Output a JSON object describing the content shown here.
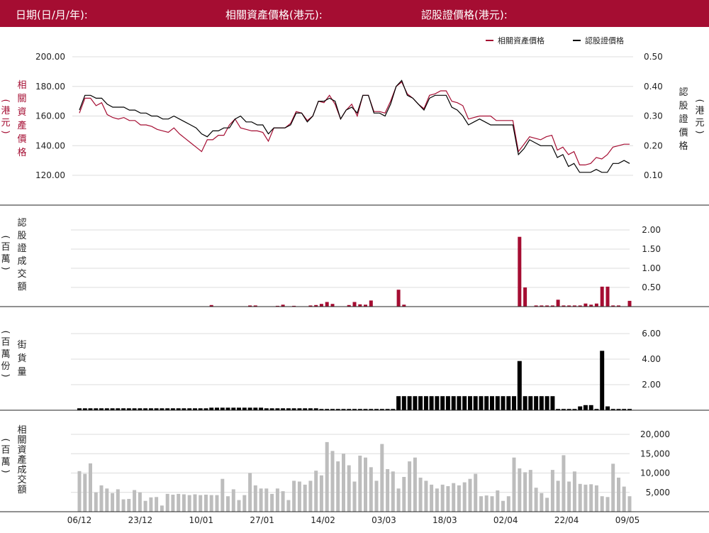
{
  "header": {
    "date_label": "日期(日/月/年):",
    "asset_price_label": "相關資產價格(港元):",
    "warrant_price_label": "認股證價格(港元):"
  },
  "colors": {
    "brand": "#a50d32",
    "asset": "#a50d32",
    "warrant": "#000000",
    "turnover_bar": "#bdbdbd",
    "grid": "#dcdcdc"
  },
  "chart_data": [
    {
      "type": "line",
      "legend": [
        "相關資產價格",
        "認股證價格"
      ],
      "legend_position": "top-right",
      "left_axis": {
        "label_chars": [
          "相",
          "關",
          "資",
          "產",
          "價",
          "格"
        ],
        "unit": "(港元)",
        "ticks": [
          "200.00",
          "180.00",
          "160.00",
          "140.00",
          "120.00"
        ],
        "range": [
          110,
          200
        ]
      },
      "right_axis": {
        "label_chars": [
          "認",
          "股",
          "證",
          "價",
          "格"
        ],
        "unit": "(港元)",
        "ticks": [
          "0.50",
          "0.40",
          "0.30",
          "0.20",
          "0.10"
        ],
        "range": [
          0.05,
          0.5
        ]
      },
      "series": [
        {
          "name": "相關資產價格",
          "axis": "left",
          "values": [
            162,
            172,
            172,
            167,
            169,
            161,
            159,
            158,
            159,
            157,
            157,
            154,
            154,
            153,
            151,
            150,
            149,
            152,
            148,
            145,
            142,
            139,
            136,
            144,
            144,
            147,
            147,
            154,
            158,
            152,
            151,
            150,
            150,
            149,
            143,
            152,
            152,
            152,
            155,
            163,
            162,
            157,
            160,
            170,
            169,
            174,
            168,
            158,
            164,
            168,
            160,
            174,
            174,
            163,
            163,
            162,
            170,
            180,
            183,
            175,
            172,
            168,
            165,
            174,
            175,
            177,
            177,
            170,
            169,
            167,
            158,
            159,
            160,
            160,
            160,
            157,
            157,
            157,
            157,
            136,
            141,
            146,
            145,
            144,
            146,
            147,
            137,
            139,
            134,
            136,
            127,
            127,
            128,
            132,
            131,
            134,
            139,
            140,
            141,
            141
          ]
        },
        {
          "name": "認股證價格",
          "axis": "right",
          "values": [
            0.32,
            0.37,
            0.37,
            0.36,
            0.36,
            0.34,
            0.33,
            0.33,
            0.33,
            0.32,
            0.32,
            0.31,
            0.31,
            0.3,
            0.3,
            0.29,
            0.29,
            0.3,
            0.29,
            0.28,
            0.27,
            0.26,
            0.24,
            0.23,
            0.25,
            0.25,
            0.26,
            0.26,
            0.29,
            0.3,
            0.28,
            0.28,
            0.27,
            0.27,
            0.24,
            0.26,
            0.26,
            0.26,
            0.27,
            0.31,
            0.31,
            0.28,
            0.3,
            0.35,
            0.35,
            0.36,
            0.35,
            0.29,
            0.32,
            0.33,
            0.31,
            0.37,
            0.37,
            0.31,
            0.31,
            0.3,
            0.34,
            0.4,
            0.42,
            0.37,
            0.36,
            0.34,
            0.32,
            0.36,
            0.37,
            0.37,
            0.37,
            0.33,
            0.32,
            0.3,
            0.27,
            0.28,
            0.29,
            0.28,
            0.27,
            0.27,
            0.27,
            0.27,
            0.27,
            0.17,
            0.19,
            0.22,
            0.21,
            0.2,
            0.2,
            0.2,
            0.16,
            0.17,
            0.13,
            0.14,
            0.11,
            0.11,
            0.11,
            0.12,
            0.11,
            0.11,
            0.14,
            0.14,
            0.15,
            0.14
          ]
        }
      ]
    },
    {
      "type": "bar",
      "left_axis": {
        "label_chars": [
          "認",
          "股",
          "證",
          "成",
          "交",
          "額"
        ],
        "unit": "(百萬)"
      },
      "right_axis": {
        "ticks": [
          "2.00",
          "1.50",
          "1.00",
          "0.50"
        ],
        "range": [
          0,
          2.2
        ]
      },
      "values": [
        0,
        0,
        0,
        0,
        0,
        0,
        0,
        0,
        0,
        0,
        0,
        0,
        0,
        0,
        0,
        0,
        0,
        0,
        0,
        0,
        0,
        0,
        0,
        0,
        0.04,
        0,
        0,
        0,
        0,
        0,
        0,
        0.03,
        0.03,
        0,
        0,
        0,
        0.02,
        0.05,
        0,
        0.02,
        0,
        0,
        0.03,
        0.04,
        0.07,
        0.12,
        0.07,
        0.01,
        0,
        0.04,
        0.12,
        0.06,
        0.05,
        0.16,
        0,
        0,
        0,
        0,
        0.44,
        0.05,
        0,
        0,
        0,
        0,
        0,
        0,
        0,
        0,
        0,
        0,
        0,
        0,
        0,
        0,
        0,
        0,
        0,
        0,
        0,
        0,
        1.82,
        0.5,
        0,
        0.03,
        0.03,
        0.03,
        0.03,
        0.18,
        0.03,
        0.03,
        0.03,
        0.03,
        0.08,
        0.05,
        0.08,
        0.52,
        0.52,
        0.03,
        0.03,
        0,
        0.15
      ]
    },
    {
      "type": "bar",
      "left_axis": {
        "label_chars": [
          "街",
          "貨",
          "量"
        ],
        "unit": "(百萬份)"
      },
      "right_axis": {
        "ticks": [
          "6.00",
          "4.00",
          "2.00"
        ],
        "range": [
          0,
          6.5
        ]
      },
      "values": [
        0.15,
        0.15,
        0.15,
        0.15,
        0.15,
        0.15,
        0.15,
        0.15,
        0.15,
        0.15,
        0.15,
        0.15,
        0.15,
        0.15,
        0.15,
        0.15,
        0.15,
        0.15,
        0.15,
        0.15,
        0.15,
        0.15,
        0.15,
        0.15,
        0.2,
        0.2,
        0.2,
        0.2,
        0.2,
        0.2,
        0.2,
        0.2,
        0.2,
        0.2,
        0.15,
        0.15,
        0.15,
        0.15,
        0.15,
        0.15,
        0.15,
        0.15,
        0.15,
        0.15,
        0.1,
        0.1,
        0.1,
        0.1,
        0.1,
        0.1,
        0.1,
        0.1,
        0.1,
        0.1,
        0.1,
        0.1,
        0.1,
        0.1,
        1.1,
        1.1,
        1.1,
        1.1,
        1.1,
        1.1,
        1.1,
        1.1,
        1.1,
        1.1,
        1.1,
        1.1,
        1.1,
        1.1,
        1.1,
        1.1,
        1.1,
        1.1,
        1.1,
        1.1,
        1.1,
        1.1,
        3.85,
        1.1,
        1.1,
        1.1,
        1.1,
        1.1,
        1.1,
        0.1,
        0.1,
        0.1,
        0.1,
        0.3,
        0.4,
        0.4,
        0.1,
        4.65,
        0.3,
        0.1,
        0.1,
        0.1,
        0.1
      ]
    },
    {
      "type": "bar",
      "left_axis": {
        "label_chars": [
          "相",
          "關",
          "資",
          "產",
          "成",
          "交",
          "額"
        ],
        "unit": "(百萬)"
      },
      "right_axis": {
        "ticks": [
          "20,000",
          "15,000",
          "10,000",
          "5,000"
        ],
        "range": [
          0,
          22000
        ]
      },
      "values": [
        10500,
        9800,
        12500,
        5000,
        6800,
        6000,
        4800,
        5800,
        3200,
        3300,
        5600,
        5000,
        2800,
        3700,
        3800,
        1600,
        4600,
        4400,
        4600,
        4500,
        4300,
        4500,
        4300,
        4400,
        4300,
        4300,
        8500,
        4000,
        5800,
        3000,
        4300,
        10000,
        6800,
        6000,
        6000,
        4600,
        6000,
        5300,
        3000,
        8000,
        7800,
        7000,
        8000,
        10600,
        9400,
        18000,
        15700,
        13000,
        15000,
        12000,
        7800,
        14500,
        14000,
        11500,
        8000,
        17500,
        11000,
        10400,
        6000,
        9000,
        13000,
        14000,
        8800,
        8000,
        7000,
        6000,
        7000,
        6600,
        7400,
        6800,
        7600,
        8500,
        9800,
        4000,
        4200,
        4000,
        5500,
        2800,
        4000,
        14000,
        11200,
        10200,
        10800,
        6200,
        4800,
        3600,
        10800,
        8000,
        14600,
        7800,
        10400,
        7200,
        7000,
        7100,
        6800,
        4000,
        3800,
        12400,
        8800,
        6500,
        4000
      ]
    }
  ],
  "x_axis": {
    "labels": [
      "06/12",
      "23/12",
      "10/01",
      "27/01",
      "14/02",
      "03/03",
      "18/03",
      "02/04",
      "22/04",
      "09/05"
    ]
  }
}
